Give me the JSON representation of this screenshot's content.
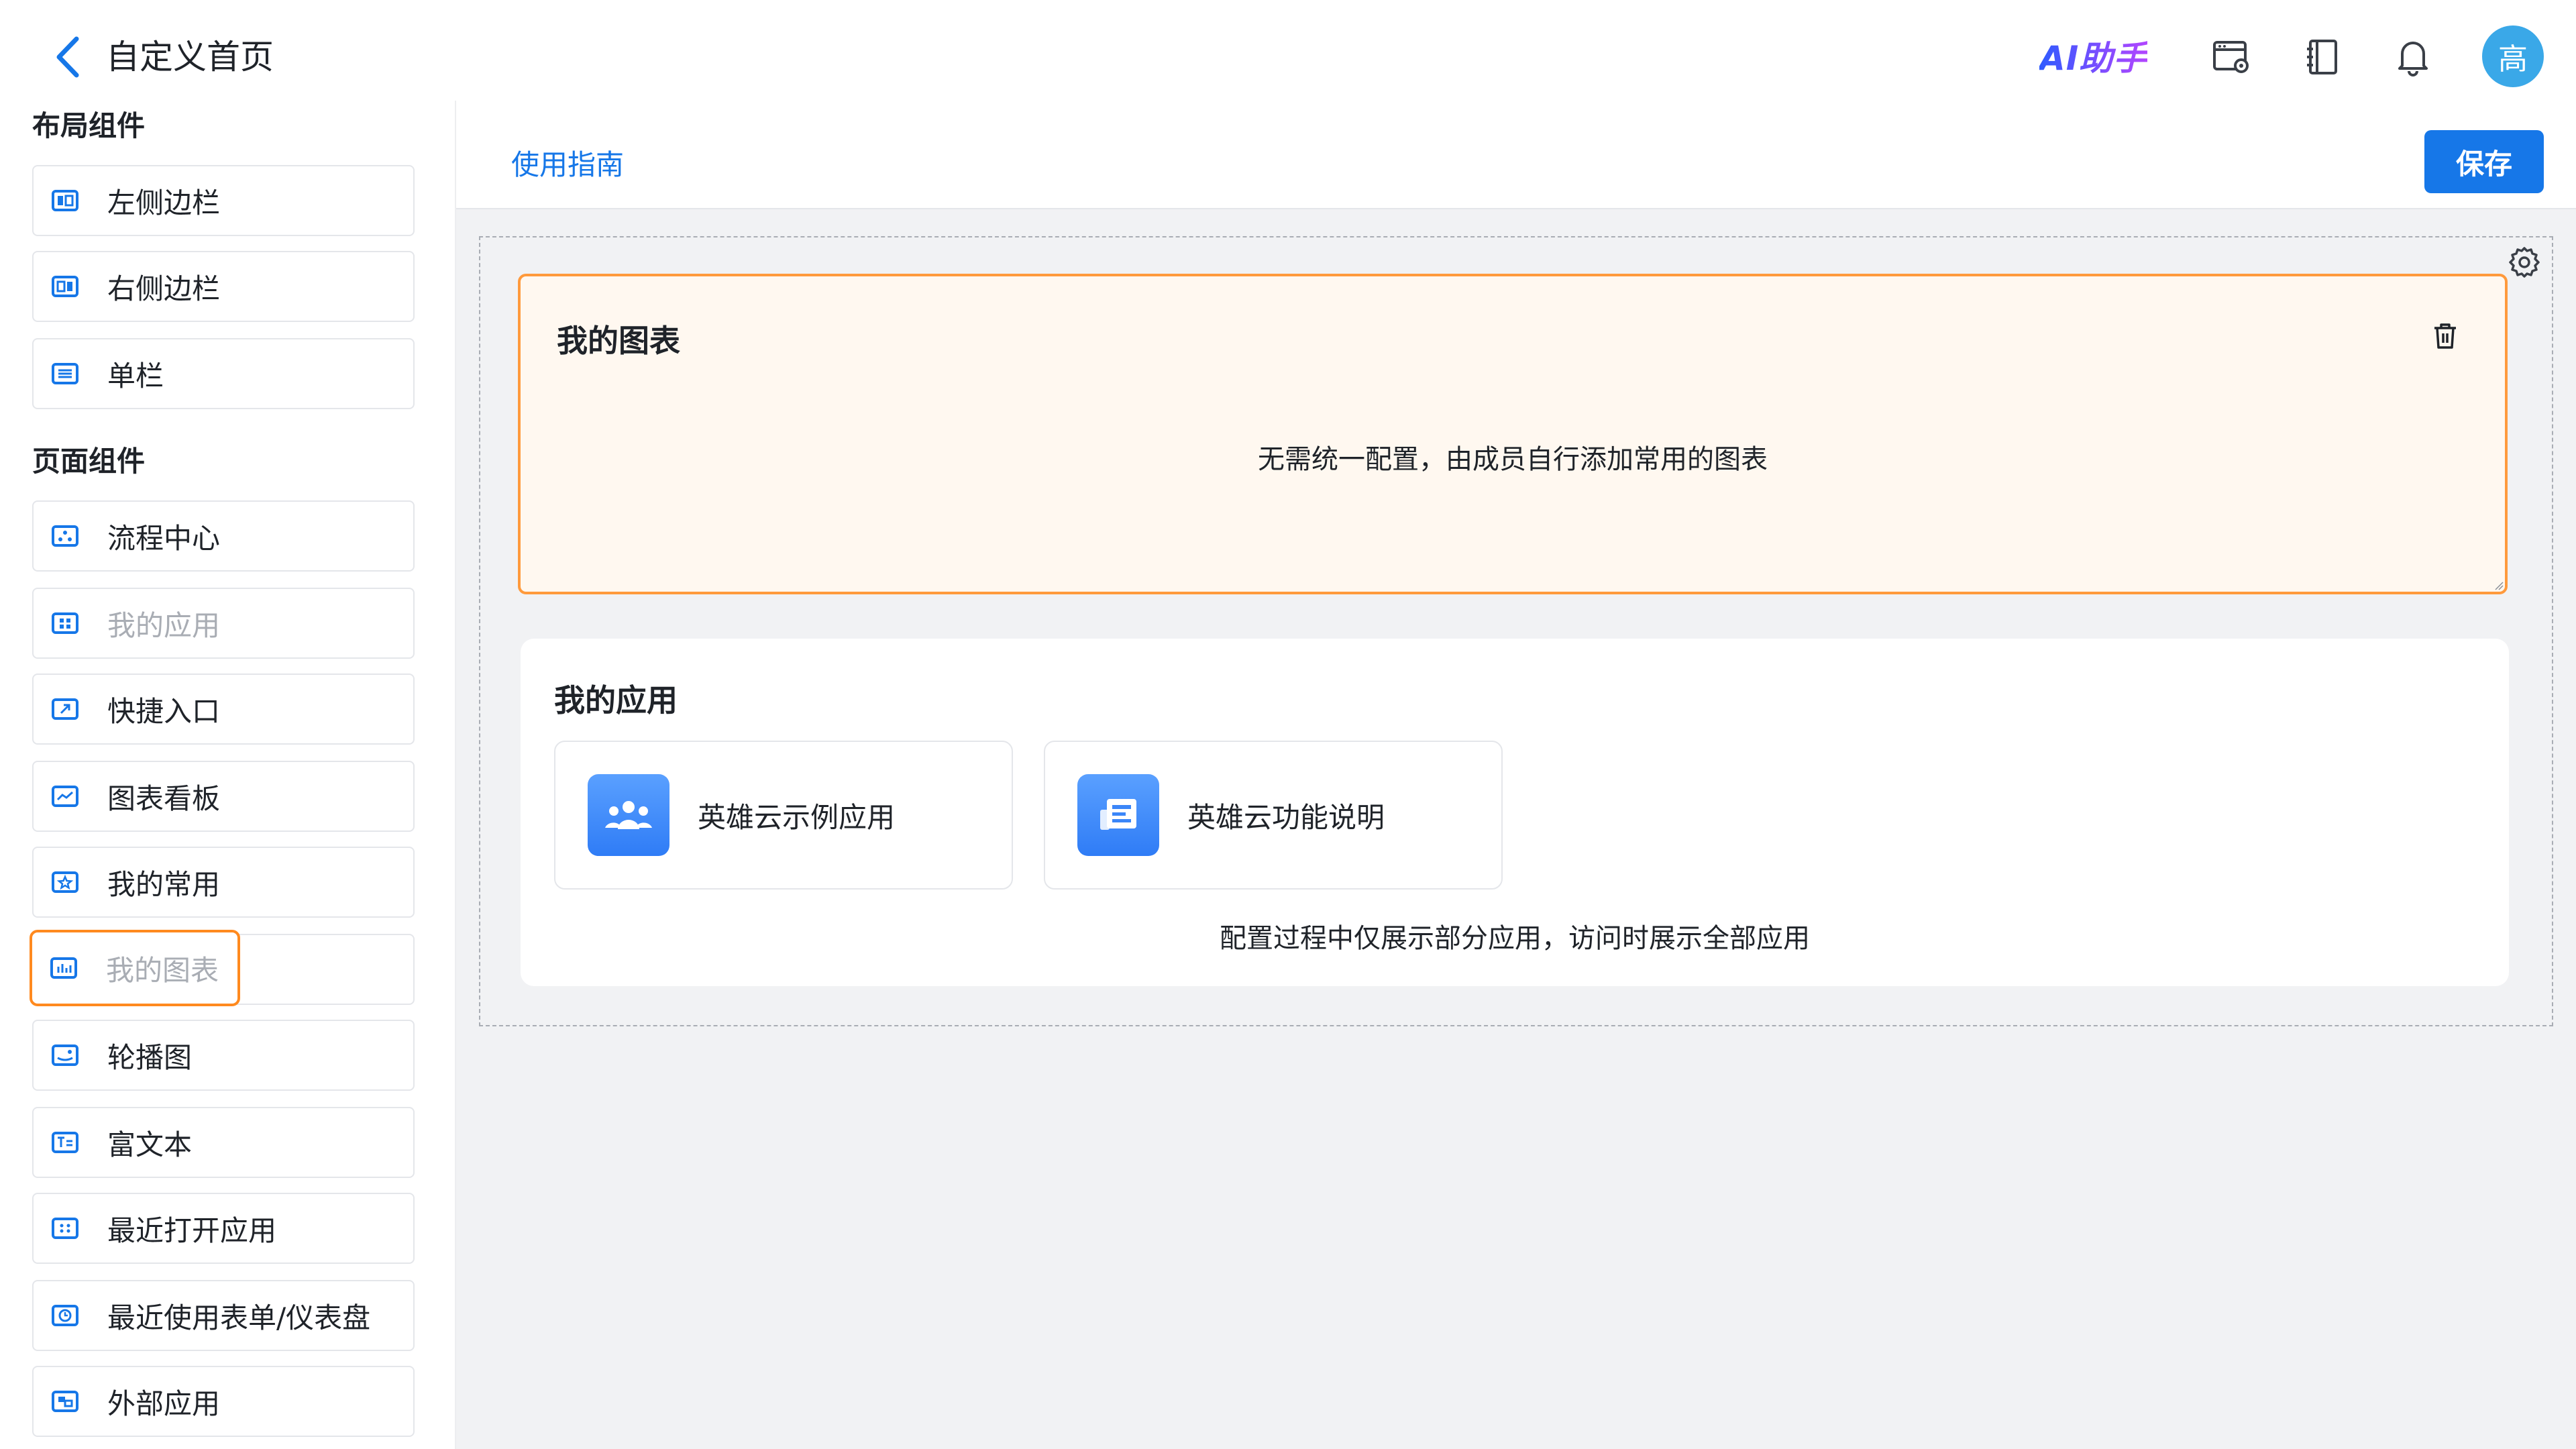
{
  "header": {
    "title": "自定义首页",
    "ai_label": "AI助手",
    "avatar_text": "高"
  },
  "sidebar": {
    "layout_section": "布局组件",
    "layout_items": [
      {
        "label": "左侧边栏",
        "icon": "left-sidebar-layout-icon",
        "disabled": false
      },
      {
        "label": "右侧边栏",
        "icon": "right-sidebar-layout-icon",
        "disabled": false
      },
      {
        "label": "单栏",
        "icon": "single-column-layout-icon",
        "disabled": false
      }
    ],
    "page_section": "页面组件",
    "page_items": [
      {
        "label": "流程中心",
        "icon": "workflow-icon",
        "disabled": false
      },
      {
        "label": "我的应用",
        "icon": "apps-grid-icon",
        "disabled": true
      },
      {
        "label": "快捷入口",
        "icon": "shortcut-icon",
        "disabled": false
      },
      {
        "label": "图表看板",
        "icon": "line-chart-icon",
        "disabled": false
      },
      {
        "label": "我的常用",
        "icon": "star-icon",
        "disabled": false
      },
      {
        "label": "我的图表",
        "icon": "bar-chart-icon",
        "disabled": true
      },
      {
        "label": "轮播图",
        "icon": "carousel-icon",
        "disabled": false
      },
      {
        "label": "富文本",
        "icon": "rich-text-icon",
        "disabled": false
      },
      {
        "label": "最近打开应用",
        "icon": "recent-apps-icon",
        "disabled": false
      },
      {
        "label": "最近使用表单/仪表盘",
        "icon": "clock-icon",
        "disabled": false
      },
      {
        "label": "外部应用",
        "icon": "external-app-icon",
        "disabled": false
      }
    ]
  },
  "main": {
    "guide_label": "使用指南",
    "save_label": "保存",
    "chart_widget": {
      "title": "我的图表",
      "hint": "无需统一配置，由成员自行添加常用的图表"
    },
    "apps_widget": {
      "title": "我的应用",
      "apps": [
        {
          "name": "英雄云示例应用",
          "icon": "team-icon"
        },
        {
          "name": "英雄云功能说明",
          "icon": "document-icon"
        }
      ],
      "note": "配置过程中仅展示部分应用，访问时展示全部应用"
    }
  },
  "colors": {
    "accent": "#1677e8",
    "drag_highlight": "#ff9a3c",
    "drag_bg": "#fff8f0",
    "canvas_bg": "#f1f2f4",
    "avatar": "#3aa8e8"
  }
}
